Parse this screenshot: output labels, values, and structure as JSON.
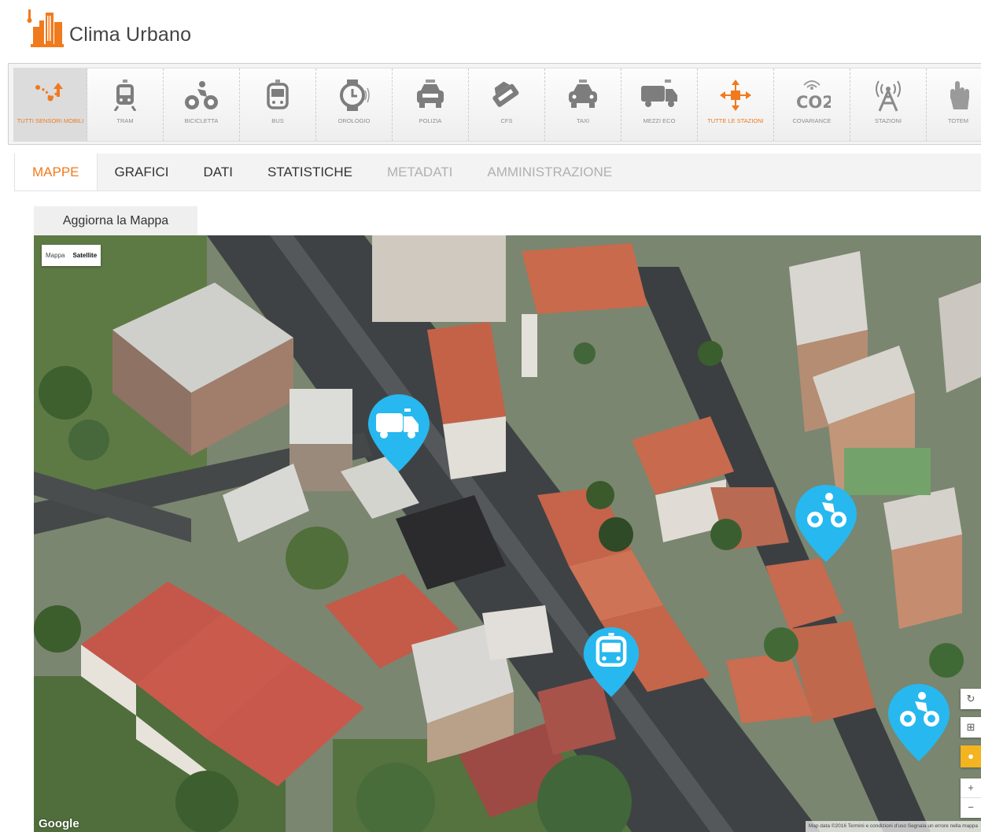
{
  "app": {
    "title": "Clima Urbano",
    "accent": "#f07a1e"
  },
  "toolbar": {
    "items": [
      {
        "id": "all-mobile",
        "label": "TUTTI SENSORI MOBILI",
        "icon": "all-mobile-sensors-icon",
        "active": true
      },
      {
        "id": "tram",
        "label": "TRAM",
        "icon": "tram-icon"
      },
      {
        "id": "bike",
        "label": "BICICLETTA",
        "icon": "bicycle-icon"
      },
      {
        "id": "bus",
        "label": "BUS",
        "icon": "bus-icon"
      },
      {
        "id": "watch",
        "label": "OROLOGIO",
        "icon": "watch-icon"
      },
      {
        "id": "police",
        "label": "POLIZIA",
        "icon": "police-car-icon"
      },
      {
        "id": "cfs",
        "label": "CFS",
        "icon": "cfs-icon"
      },
      {
        "id": "taxi",
        "label": "TAXI",
        "icon": "taxi-icon"
      },
      {
        "id": "eco",
        "label": "MEZZI ECO",
        "icon": "eco-truck-icon"
      },
      {
        "id": "all-stations",
        "label": "TUTTE LE STAZIONI",
        "icon": "all-stations-icon"
      },
      {
        "id": "covariance",
        "label": "COVARIANCE",
        "icon": "co2-icon"
      },
      {
        "id": "stations",
        "label": "STAZIONI",
        "icon": "antenna-icon"
      },
      {
        "id": "totem",
        "label": "TOTEM",
        "icon": "totem-hand-icon"
      }
    ],
    "co2_text": "CO2"
  },
  "tabs": [
    {
      "label": "MAPPE",
      "state": "active"
    },
    {
      "label": "GRAFICI",
      "state": "normal"
    },
    {
      "label": "DATI",
      "state": "normal"
    },
    {
      "label": "STATISTICHE",
      "state": "normal"
    },
    {
      "label": "METADATI",
      "state": "disabled"
    },
    {
      "label": "AMMINISTRAZIONE",
      "state": "disabled"
    }
  ],
  "refresh_button": "Aggiorna la Mappa",
  "map": {
    "type_control": {
      "map": "Mappa",
      "satellite": "Satellite"
    },
    "markers": [
      {
        "type": "eco-truck",
        "name": "marker-eco-truck"
      },
      {
        "type": "bicycle",
        "name": "marker-bicycle-1"
      },
      {
        "type": "bus",
        "name": "marker-bus"
      },
      {
        "type": "bicycle",
        "name": "marker-bicycle-2"
      }
    ],
    "marker_color": "#27b8ef",
    "google_logo": "Google",
    "footer": "Map data ©2016  Termini e condizioni d'uso  Segnala un errore nella mappa"
  }
}
